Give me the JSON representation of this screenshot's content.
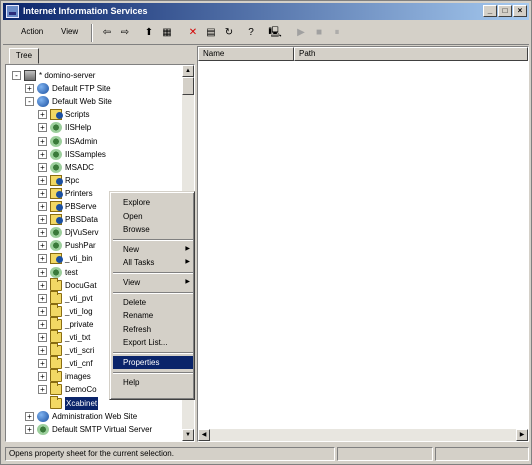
{
  "window": {
    "title": "Internet Information Services",
    "controls": {
      "minimize": "_",
      "maximize": "□",
      "close": "×"
    }
  },
  "menubar": {
    "items": [
      {
        "label": "Action",
        "hotkey": "A"
      },
      {
        "label": "View",
        "hotkey": "V"
      }
    ]
  },
  "toolbar": {
    "buttons": [
      {
        "icon": "back-arrow-icon",
        "glyph": "⇦"
      },
      {
        "icon": "forward-arrow-icon",
        "glyph": "⇨"
      },
      {
        "icon": "up-folder-icon",
        "glyph": "⬆"
      },
      {
        "icon": "show-tree-icon",
        "glyph": "▦"
      },
      {
        "icon": "delete-icon",
        "glyph": "✕",
        "color": "#d40000"
      },
      {
        "icon": "properties-icon",
        "glyph": "▤"
      },
      {
        "icon": "refresh-icon",
        "glyph": "↻"
      },
      {
        "icon": "help-icon",
        "glyph": "?"
      },
      {
        "icon": "computer-icon",
        "glyph": "🖳"
      },
      {
        "icon": "play-icon",
        "glyph": "▶"
      },
      {
        "icon": "stop-icon",
        "glyph": "■"
      },
      {
        "icon": "pause-icon",
        "glyph": "⏸"
      }
    ]
  },
  "tree_tab": {
    "label": "Tree"
  },
  "tree": {
    "items": [
      {
        "label": "* domino-server",
        "icon": "server",
        "level": 0,
        "expander": "-"
      },
      {
        "label": "Default FTP Site",
        "icon": "globe",
        "level": 1,
        "expander": "+"
      },
      {
        "label": "Default Web Site",
        "icon": "globe",
        "level": 1,
        "expander": "-"
      },
      {
        "label": "Scripts",
        "icon": "site",
        "level": 2,
        "expander": "+"
      },
      {
        "label": "IISHelp",
        "icon": "gear",
        "level": 2,
        "expander": "+"
      },
      {
        "label": "IISAdmin",
        "icon": "gear",
        "level": 2,
        "expander": "+"
      },
      {
        "label": "IISSamples",
        "icon": "gear",
        "level": 2,
        "expander": "+"
      },
      {
        "label": "MSADC",
        "icon": "gear",
        "level": 2,
        "expander": "+"
      },
      {
        "label": "Rpc",
        "icon": "site",
        "level": 2,
        "expander": "+"
      },
      {
        "label": "Printers",
        "icon": "site",
        "level": 2,
        "expander": "+"
      },
      {
        "label": "PBServe",
        "icon": "site",
        "level": 2,
        "expander": "+"
      },
      {
        "label": "PBSData",
        "icon": "site",
        "level": 2,
        "expander": "+"
      },
      {
        "label": "DjVuServ",
        "icon": "gear",
        "level": 2,
        "expander": "+"
      },
      {
        "label": "PushPar",
        "icon": "gear",
        "level": 2,
        "expander": "+"
      },
      {
        "label": "_vti_bin",
        "icon": "site",
        "level": 2,
        "expander": "+"
      },
      {
        "label": "test",
        "icon": "gear",
        "level": 2,
        "expander": "+"
      },
      {
        "label": "DocuGat",
        "icon": "folder",
        "level": 2,
        "expander": "+"
      },
      {
        "label": "_vti_pvt",
        "icon": "folder",
        "level": 2,
        "expander": "+"
      },
      {
        "label": "_vti_log",
        "icon": "folder",
        "level": 2,
        "expander": "+"
      },
      {
        "label": "_private",
        "icon": "folder",
        "level": 2,
        "expander": "+"
      },
      {
        "label": "_vti_txt",
        "icon": "folder",
        "level": 2,
        "expander": "+"
      },
      {
        "label": "_vti_scri",
        "icon": "folder",
        "level": 2,
        "expander": "+"
      },
      {
        "label": "_vti_cnf",
        "icon": "folder",
        "level": 2,
        "expander": "+"
      },
      {
        "label": "images",
        "icon": "folder",
        "level": 2,
        "expander": "+"
      },
      {
        "label": "DemoCo",
        "icon": "folder",
        "level": 2,
        "expander": "+"
      },
      {
        "label": "Xcabinet",
        "icon": "folder",
        "level": 2,
        "expander": "",
        "selected": true
      },
      {
        "label": "Administration Web Site",
        "icon": "globe",
        "level": 1,
        "expander": "+"
      },
      {
        "label": "Default SMTP Virtual Server",
        "icon": "gear",
        "level": 1,
        "expander": "+"
      }
    ]
  },
  "list": {
    "columns": [
      "Name",
      "Path"
    ]
  },
  "context_menu": {
    "items": [
      {
        "label": "Explore"
      },
      {
        "label": "Open"
      },
      {
        "label": "Browse"
      },
      {
        "separator": true
      },
      {
        "label": "New",
        "submenu": true
      },
      {
        "label": "All Tasks",
        "submenu": true
      },
      {
        "separator": true
      },
      {
        "label": "View",
        "submenu": true
      },
      {
        "separator": true
      },
      {
        "label": "Delete"
      },
      {
        "label": "Rename"
      },
      {
        "label": "Refresh"
      },
      {
        "label": "Export List..."
      },
      {
        "separator": true
      },
      {
        "label": "Properties",
        "highlighted": true
      },
      {
        "separator": true
      },
      {
        "label": "Help"
      }
    ]
  },
  "statusbar": {
    "text": "Opens property sheet for the current selection."
  },
  "colors": {
    "titlebar_start": "#0a246a",
    "titlebar_end": "#a6caf0",
    "selection": "#0a246a",
    "face": "#d4d0c8"
  }
}
